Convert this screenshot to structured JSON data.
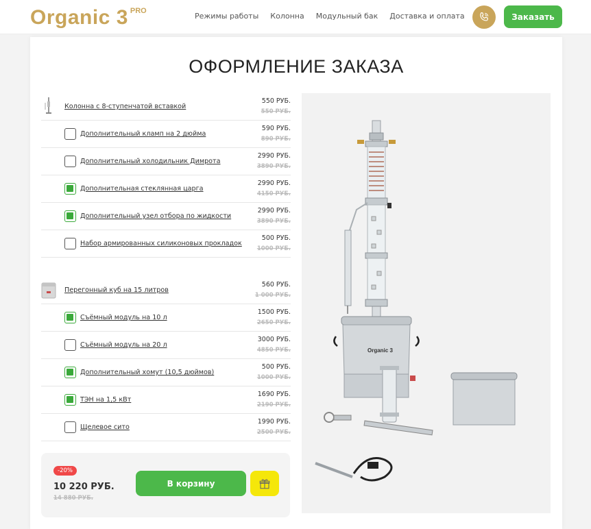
{
  "header": {
    "logo_text": "Organic 3",
    "logo_pro": "PRO",
    "nav": [
      "Режимы работы",
      "Колонна",
      "Модульный бак",
      "Доставка и оплата"
    ],
    "order_button": "Заказать"
  },
  "page": {
    "title": "ОФОРМЛЕНИЕ ЗАКАЗА"
  },
  "group1": {
    "main": {
      "name": "Колонна с 8-ступенчатой вставкой",
      "price": "550 РУБ.",
      "old": "550 РУБ."
    },
    "options": [
      {
        "name": "Дополнительный кламп на 2 дюйма",
        "price": "590 РУБ.",
        "old": "890 РУБ.",
        "checked": false
      },
      {
        "name": "Дополнительный холодильник Димрота",
        "price": "2990 РУБ.",
        "old": "3890 РУБ.",
        "checked": false
      },
      {
        "name": "Дополнительная стеклянная царга",
        "price": "2990 РУБ.",
        "old": "4150 РУБ.",
        "checked": true
      },
      {
        "name": "Дополнительный узел отбора по жидкости",
        "price": "2990 РУБ.",
        "old": "3890 РУБ.",
        "checked": true
      },
      {
        "name": "Набор армированных силиконовых прокладок",
        "price": "500 РУБ.",
        "old": "1000 РУБ.",
        "checked": false
      }
    ]
  },
  "group2": {
    "main": {
      "name": "Перегонный куб на 15 литров",
      "price": "560 РУБ.",
      "old": "1 000 РУБ."
    },
    "options": [
      {
        "name": "Съёмный модуль на 10 л",
        "price": "1500 РУБ.",
        "old": "2650 РУБ.",
        "checked": true
      },
      {
        "name": "Съёмный модуль на 20 л",
        "price": "3000 РУБ.",
        "old": "4850 РУБ.",
        "checked": false
      },
      {
        "name": "Дополнительный хомут (10,5 дюймов)",
        "price": "500 РУБ.",
        "old": "1000 РУБ.",
        "checked": true
      },
      {
        "name": "ТЭН на 1,5 кВт",
        "price": "1690 РУБ.",
        "old": "2190 РУБ.",
        "checked": true
      },
      {
        "name": "Щелевое сито",
        "price": "1990 РУБ.",
        "old": "2500 РУБ.",
        "checked": false
      }
    ]
  },
  "summary": {
    "discount": "-20%",
    "total": "10 220 РУБ.",
    "total_old": "14 880 РУБ.",
    "cart_button": "В корзину"
  },
  "photo": {
    "brand": "Organic 3"
  },
  "colors": {
    "gold": "#c9a55a",
    "green": "#4cb84a",
    "red": "#f04848",
    "yellow": "#f5e70a"
  }
}
